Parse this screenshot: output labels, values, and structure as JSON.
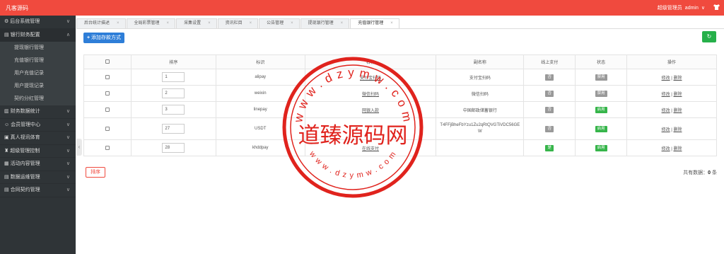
{
  "header": {
    "brand": "凡客源码",
    "role": "超级管理员",
    "user": "admin",
    "user_chevron": "∨"
  },
  "sidebar": {
    "items": [
      {
        "label": "后台系统管理",
        "icon": "gear-icon"
      },
      {
        "label": "银行财务配置",
        "icon": "bank-icon",
        "open": true,
        "children": [
          "提现银行管理",
          "充值银行管理",
          "用户充值记录",
          "用户提现记录",
          "契约分红管理"
        ]
      },
      {
        "label": "财务数据统计",
        "icon": "chart-icon"
      },
      {
        "label": "会员管理中心",
        "icon": "user-icon"
      },
      {
        "label": "真人视讯体育",
        "icon": "video-icon"
      },
      {
        "label": "超级管理控制",
        "icon": "lock-icon"
      },
      {
        "label": "活动内容管理",
        "icon": "list-icon"
      },
      {
        "label": "数据运维管理",
        "icon": "database-icon"
      },
      {
        "label": "合同契约管理",
        "icon": "document-icon"
      }
    ]
  },
  "tabs": [
    {
      "label": "后台统计描述"
    },
    {
      "label": "全局彩票管理"
    },
    {
      "label": "采集设置"
    },
    {
      "label": "资讯栏目"
    },
    {
      "label": "公告管理"
    },
    {
      "label": "提现银行管理"
    },
    {
      "label": "充值银行管理",
      "active": true
    }
  ],
  "toolbar": {
    "add_label": "添加存款方式",
    "add_icon": "plus-icon",
    "refresh_icon": "refresh-icon"
  },
  "table": {
    "columns": [
      "",
      "排序",
      "标识",
      "名称",
      "副名称",
      "线上支付",
      "状态",
      "操作"
    ],
    "rows": [
      {
        "sort": "1",
        "key": "alipay",
        "name": "支付宝扫码",
        "subname": "支付宝扫码",
        "online": "否",
        "status": "禁用",
        "edit": "修改",
        "sep": "|",
        "del": "删除"
      },
      {
        "sort": "2",
        "key": "weixin",
        "name": "微信扫码",
        "subname": "微信扫码",
        "online": "否",
        "status": "禁用",
        "edit": "修改",
        "sep": "|",
        "del": "删除"
      },
      {
        "sort": "3",
        "key": "linepay",
        "name": "网银入款",
        "subname": "中国邮政储蓄银行",
        "online": "否",
        "status": "启用",
        "edit": "修改",
        "sep": "|",
        "del": "删除"
      },
      {
        "sort": "27",
        "key": "USDT",
        "name": "",
        "subname": "T4FFjBheFbYzu1Zu2qRtQVGTiVDC56GEW",
        "online": "否",
        "status": "启用",
        "edit": "修改",
        "sep": "|",
        "del": "删除"
      },
      {
        "sort": "28",
        "key": "khddpay",
        "name": "在线支付",
        "subname": "",
        "online": "是",
        "status": "启用",
        "edit": "修改",
        "sep": "|",
        "del": "删除"
      }
    ]
  },
  "footer": {
    "sort_button": "排序",
    "total_label": "共有数据：",
    "total_count": "0",
    "total_unit": " 条"
  },
  "watermark": {
    "domain_text": "w w w . d z y m w . c o m",
    "center_text": "道臻源码网",
    "color": "#e0231d"
  },
  "colors": {
    "brand": "#f04a3e",
    "sidebar": "#2f3437",
    "primary": "#2e7ed8",
    "success": "#26b04a",
    "tag_gray": "#999999",
    "tag_green": "#36b54a"
  }
}
